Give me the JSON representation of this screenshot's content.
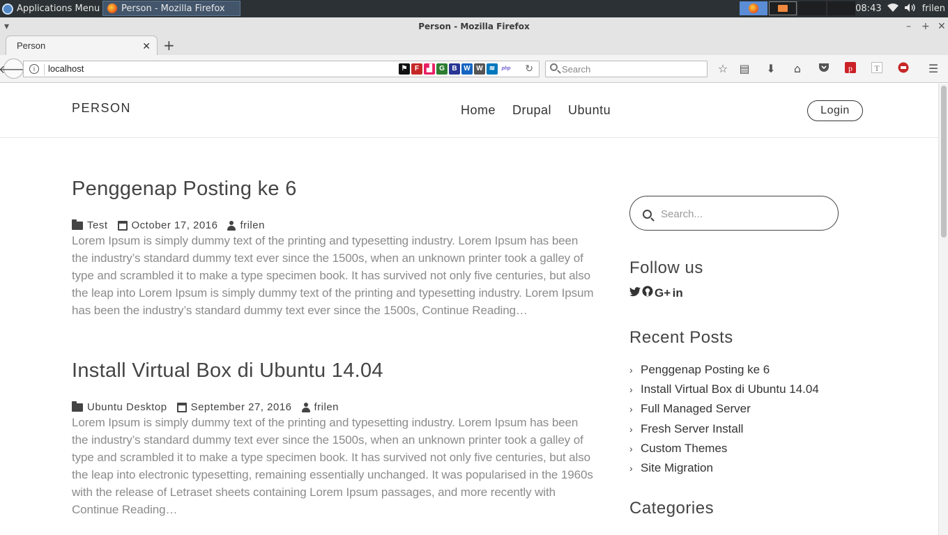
{
  "taskbar": {
    "apps_menu": "Applications Menu",
    "window_title": "Person - Mozilla Firefox",
    "clock": "08:43",
    "user": "frilen"
  },
  "browser": {
    "window_title": "Person - Mozilla Firefox",
    "tab_title": "Person",
    "url": "localhost",
    "search_placeholder": "Search",
    "extensions": [
      {
        "icon": "flag-icon",
        "glyph": "⚑",
        "color": "#111111"
      },
      {
        "icon": "font-icon",
        "glyph": "F",
        "color": "#c62828"
      },
      {
        "icon": "stairs-icon",
        "glyph": "▟",
        "color": "#e91e63"
      },
      {
        "icon": "g-icon",
        "glyph": "G",
        "color": "#2e7d32"
      },
      {
        "icon": "b-icon",
        "glyph": "B",
        "color": "#283593"
      },
      {
        "icon": "w-icon",
        "glyph": "W",
        "color": "#1565c0"
      },
      {
        "icon": "wordpress-icon",
        "glyph": "W",
        "color": "#555555"
      },
      {
        "icon": "wave-icon",
        "glyph": "≋",
        "color": "#0277bd"
      },
      {
        "icon": "php-icon",
        "glyph": "php",
        "color": "#6a5acd"
      }
    ]
  },
  "site": {
    "brand": "PERSON",
    "nav": [
      "Home",
      "Drupal",
      "Ubuntu"
    ],
    "login": "Login"
  },
  "posts": [
    {
      "title": "Penggenap Posting ke 6",
      "category": "Test",
      "date": "October 17, 2016",
      "author": "frilen",
      "excerpt": "Lorem Ipsum is simply dummy text of the printing and typesetting industry. Lorem Ipsum has been the industry’s standard dummy text ever since the 1500s, when an unknown printer took a galley of type and scrambled it to make a type specimen book. It has survived not only five centuries, but also the leap into Lorem Ipsum is simply dummy text of the printing and typesetting industry. Lorem Ipsum has been the industry’s standard dummy text ever since the 1500s, Continue Reading…"
    },
    {
      "title": "Install Virtual Box di Ubuntu 14.04",
      "category": "Ubuntu Desktop",
      "date": "September 27, 2016",
      "author": "frilen",
      "excerpt": "Lorem Ipsum is simply dummy text of the printing and typesetting industry. Lorem Ipsum has been the industry’s standard dummy text ever since the 1500s, when an unknown printer took a galley of type and scrambled it to make a type specimen book. It has survived not only five centuries, but also the leap into electronic typesetting, remaining essentially unchanged. It was popularised in the 1960s with the release of Letraset sheets containing Lorem Ipsum passages, and more recently with Continue Reading…"
    }
  ],
  "sidebar": {
    "search_placeholder": "Search...",
    "follow_title": "Follow us",
    "social": [
      {
        "icon": "twitter-icon",
        "glyph": "🐦"
      },
      {
        "icon": "github-icon",
        "glyph": "●"
      },
      {
        "icon": "google-plus-icon",
        "glyph": "G+"
      },
      {
        "icon": "linkedin-icon",
        "glyph": "in"
      }
    ],
    "recent_title": "Recent Posts",
    "recent_posts": [
      "Penggenap Posting ke 6",
      "Install Virtual Box di Ubuntu 14.04",
      "Full Managed Server",
      "Fresh Server Install",
      "Custom Themes",
      "Site Migration"
    ],
    "categories_title": "Categories"
  }
}
